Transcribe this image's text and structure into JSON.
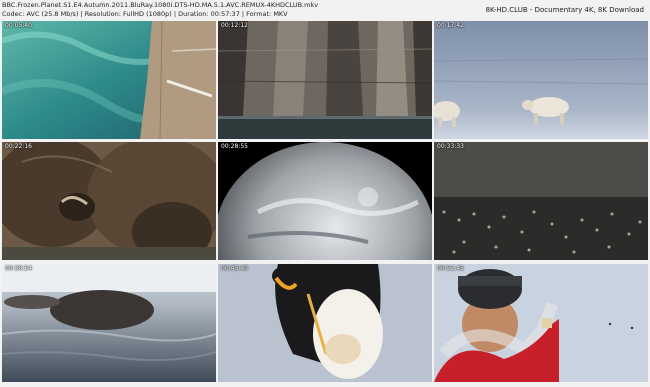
{
  "header": {
    "filename": "BBC.Frozen.Planet.S1.E4.Autumn.2011.BluRay.1080i.DTS-HD.MA.5.1.AVC.REMUX-4KHDCLUB.mkv",
    "meta": "Codec: AVC (25.8 Mb/s)  |  Resolution: FullHD (1080p)  |  Duration: 00:57:37  |  Format: MKV",
    "brand": "8K-HD.CLUB - Documentary 4K, 8K Download"
  },
  "thumbnails": [
    {
      "timestamp": "00:05:40",
      "scene": "aerial-coast"
    },
    {
      "timestamp": "00:12:12",
      "scene": "sea-cliffs"
    },
    {
      "timestamp": "00:17:42",
      "scene": "polar-bears"
    },
    {
      "timestamp": "00:22:16",
      "scene": "musk-oxen"
    },
    {
      "timestamp": "00:28:55",
      "scene": "planet-earth"
    },
    {
      "timestamp": "00:33:33",
      "scene": "penguin-colony"
    },
    {
      "timestamp": "00:38:54",
      "scene": "walrus-in-water"
    },
    {
      "timestamp": "00:45:40",
      "scene": "emperor-penguin"
    },
    {
      "timestamp": "00:52:45",
      "scene": "explorer"
    }
  ]
}
